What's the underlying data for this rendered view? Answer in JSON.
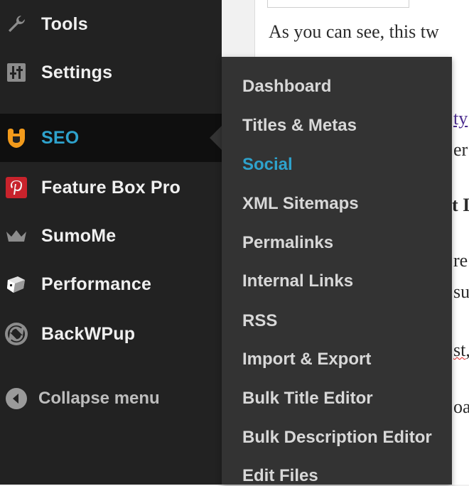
{
  "sidebar": {
    "items": [
      {
        "label": "Tools",
        "icon": "wrench-icon"
      },
      {
        "label": "Settings",
        "icon": "sliders-icon"
      },
      {
        "label": "SEO",
        "icon": "seo-plugin-icon",
        "active": true
      },
      {
        "label": "Feature Box Pro",
        "icon": "pinterest-icon"
      },
      {
        "label": "SumoMe",
        "icon": "crown-icon"
      },
      {
        "label": "Performance",
        "icon": "cube-icon"
      },
      {
        "label": "BackWPup",
        "icon": "sync-icon"
      }
    ],
    "collapse_label": "Collapse menu"
  },
  "seo_submenu": {
    "items": [
      "Dashboard",
      "Titles & Metas",
      "Social",
      "XML Sitemaps",
      "Permalinks",
      "Internal Links",
      "RSS",
      "Import & Export",
      "Bulk Title Editor",
      "Bulk Description Editor",
      "Edit Files"
    ],
    "current": "Social"
  },
  "content": {
    "snippets": [
      "As you can see, this tw",
      "ty",
      "er",
      "t I",
      "re",
      "su",
      "st,",
      "oa"
    ]
  },
  "colors": {
    "sidebar_bg": "#222222",
    "flyout_bg": "#333333",
    "accent": "#2ea2cc",
    "seo_icon": "#f29a1b",
    "pinterest_red": "#c8232c"
  }
}
